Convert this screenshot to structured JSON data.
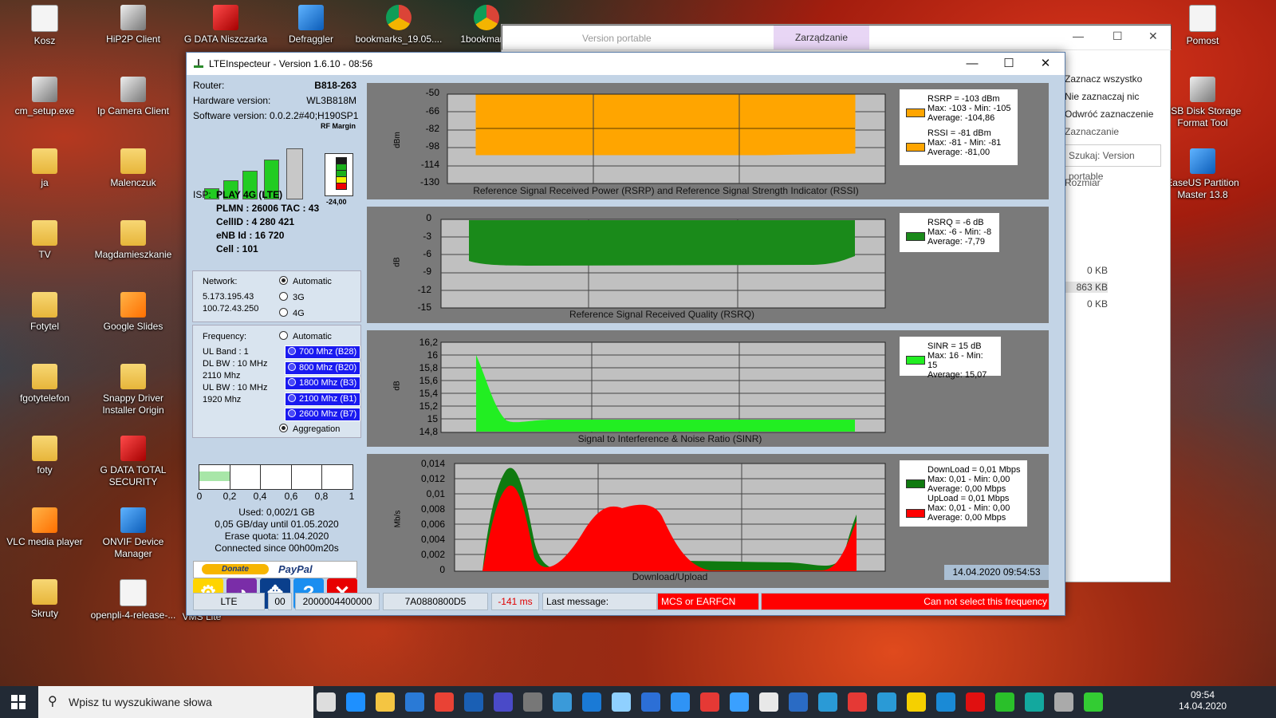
{
  "desktop": {
    "icons": [
      {
        "label": "Kosz",
        "kind": "file"
      },
      {
        "label": "HiP2P Client",
        "kind": "app"
      },
      {
        "label": "G DATA Niszczarka",
        "kind": "red"
      },
      {
        "label": "Defraggler",
        "kind": "blue"
      },
      {
        "label": "bookmarks_19.05....",
        "kind": "chrome"
      },
      {
        "label": "1bookmarks",
        "kind": "chrome"
      },
      {
        "label": "cm_setup.exe",
        "kind": "app"
      },
      {
        "label": "Ip Camera Client",
        "kind": "app"
      },
      {
        "label": "ja",
        "kind": "folder"
      },
      {
        "label": "Malenczuk",
        "kind": "folder"
      },
      {
        "label": "TV",
        "kind": "folder"
      },
      {
        "label": "Magdamieszkanie",
        "kind": "folder"
      },
      {
        "label": "Fotytel",
        "kind": "folder"
      },
      {
        "label": "Google Slides",
        "kind": "orange"
      },
      {
        "label": "fgotytelefon",
        "kind": "folder"
      },
      {
        "label": "Snappy Driver Installer Origin",
        "kind": "folder"
      },
      {
        "label": "foty",
        "kind": "folder"
      },
      {
        "label": "G DATA TOTAL SECURITY",
        "kind": "red"
      },
      {
        "label": "VLC media player",
        "kind": "orange"
      },
      {
        "label": "ONVIF Device Manager",
        "kind": "blue"
      },
      {
        "label": "Skruty",
        "kind": "folder"
      },
      {
        "label": "openpli-4-release-...",
        "kind": "file"
      },
      {
        "label": "Pomost",
        "kind": "file"
      },
      {
        "label": "USB Disk Storage Format Tool",
        "kind": "app"
      },
      {
        "label": "EaseUS Partition Master 13.8",
        "kind": "blue"
      }
    ],
    "partial_label": "VMS Lite"
  },
  "explorer": {
    "quick_access": "Version portable",
    "ribbon_tab": "Zarządzanie",
    "menu": [
      "Zaznacz wszystko",
      "Nie zaznaczaj nic",
      "Odwróć zaznaczenie",
      "Zaznaczanie"
    ],
    "search_placeholder": "Szukaj: Version portable",
    "column": "Rozmiar",
    "sizes": [
      "0 KB",
      "863 KB",
      "0 KB"
    ]
  },
  "window": {
    "title": "LTEInspecteur - Version 1.6.10 - 08:56",
    "minimize": "—",
    "maximize": "☐",
    "close": "✕"
  },
  "router": {
    "router_label": "Router:",
    "router_value": "B818-263",
    "hw_label": "Hardware version:",
    "hw_value": "WL3B818M",
    "sw_label": "Software version:",
    "sw_value": "0.0.2.2#40;H190SP1",
    "rf_margin_label": "RF Margin",
    "rf_margin_value": "-24,00",
    "signal_bars_lit": 4,
    "signal_bars_total": 5
  },
  "isp": {
    "label": "ISP:",
    "name": "PLAY 4G (LTE)",
    "plmn": "PLMN : 26006 TAC : 43",
    "cellid": "CellID : 4 280 421",
    "enb": "eNB Id : 16 720",
    "cell": "Cell : 101"
  },
  "network": {
    "label": "Network:",
    "ip1": "5.173.195.43",
    "ip2": "100.72.43.250",
    "options": [
      "Automatic",
      "3G",
      "4G"
    ],
    "selected": "Automatic"
  },
  "frequency": {
    "label": "Frequency:",
    "details": [
      "UL Band : 1",
      "DL BW : 10 MHz",
      "2110 Mhz",
      "UL BW : 10 MHz",
      "1920 Mhz"
    ],
    "automatic": "Automatic",
    "bands": [
      "700 Mhz (B28)",
      "800 Mhz (B20)",
      "1800 Mhz (B3)",
      "2100 Mhz (B1)",
      "2600 Mhz (B7)"
    ],
    "aggregation": "Aggregation"
  },
  "quota": {
    "ticks": [
      "0",
      "0,2",
      "0,4",
      "0,6",
      "0,8",
      "1"
    ],
    "used_fraction": 0.002,
    "used": "Used: 0,002/1 GB",
    "per_day": "0,05 GB/day until 01.05.2020",
    "erase": "Erase quota: 11.04.2020",
    "connected": "Connected since 00h00m20s"
  },
  "donate": {
    "donate_label": "Donate",
    "paypal_label": "PayPal"
  },
  "tools": [
    "settings-icon",
    "speedometer-icon",
    "expand-icon",
    "help-icon",
    "close-icon"
  ],
  "tools_glyphs": [
    "⚙",
    "◔",
    "✥",
    "?",
    "✕"
  ],
  "charts": {
    "rsrp": {
      "title": "Reference Signal Received Power (RSRP) and Reference Signal Strength Indicator (RSSI)",
      "ylabel": "dBm",
      "yticks": [
        "-50",
        "-66",
        "-82",
        "-98",
        "-114",
        "-130"
      ],
      "legend": [
        {
          "line1": "RSRP = -103 dBm",
          "line2": "Max: -103 - Min: -105",
          "line3": "Average: -104,86",
          "color": "#ffa500"
        },
        {
          "line1": "RSSI = -81 dBm",
          "line2": "Max: -81 - Min: -81",
          "line3": "Average: -81,00",
          "color": "#ffa500"
        }
      ]
    },
    "rsrq": {
      "title": "Reference Signal Received Quality (RSRQ)",
      "ylabel": "dB",
      "yticks": [
        "0",
        "-3",
        "-6",
        "-9",
        "-12",
        "-15"
      ],
      "legend": [
        {
          "line1": "RSRQ = -6 dB",
          "line2": "Max: -6 - Min: -8",
          "line3": "Average: -7,79",
          "color": "#1a8a1a"
        }
      ]
    },
    "sinr": {
      "title": "Signal to Interference & Noise Ratio (SINR)",
      "ylabel": "dB",
      "yticks": [
        "16,2",
        "16",
        "15,8",
        "15,6",
        "15,4",
        "15,2",
        "15",
        "14,8"
      ],
      "legend": [
        {
          "line1": "SINR = 15 dB",
          "line2": "Max: 16 - Min: 15",
          "line3": "Average: 15,07",
          "color": "#22ee22"
        }
      ]
    },
    "load": {
      "title": "Download/Upload",
      "ylabel": "Mb/s",
      "yticks": [
        "0,014",
        "0,012",
        "0,01",
        "0,008",
        "0,006",
        "0,004",
        "0,002",
        "0"
      ],
      "legend": [
        {
          "line1": "DownLoad = 0,01 Mbps",
          "line2": "Max: 0,01 - Min: 0,00",
          "line3": "Average: 0,00 Mbps",
          "color": "#0f7a0f"
        },
        {
          "line1": "UpLoad = 0,01 Mbps",
          "line2": "Max: 0,01 - Min: 0,00",
          "line3": "Average: 0,00 Mbps",
          "color": "#ff0000"
        }
      ]
    }
  },
  "timestamp": "14.04.2020 09:54:53",
  "statusbar": {
    "mode": "LTE",
    "code": "00",
    "hex1": "2000004400000",
    "hex2": "7A0880800D5",
    "latency": "-141 ms",
    "last_message": "Last message:",
    "mcs": "MCS or EARFCN",
    "error": "Can not select this frequency"
  },
  "taskbar": {
    "search_placeholder": "Wpisz tu wyszukiwane słowa",
    "clock_time": "09:54",
    "clock_date": "14.04.2020"
  },
  "colors": {
    "rsrp_fill": "#ffa500",
    "rsrq_fill": "#1a8a1a",
    "sinr_fill": "#22ee22",
    "download_fill": "#0f7a0f",
    "upload_fill": "#ff0000",
    "chart_bg": "#7a7a7a",
    "plot_bg": "#c0c0c0"
  }
}
